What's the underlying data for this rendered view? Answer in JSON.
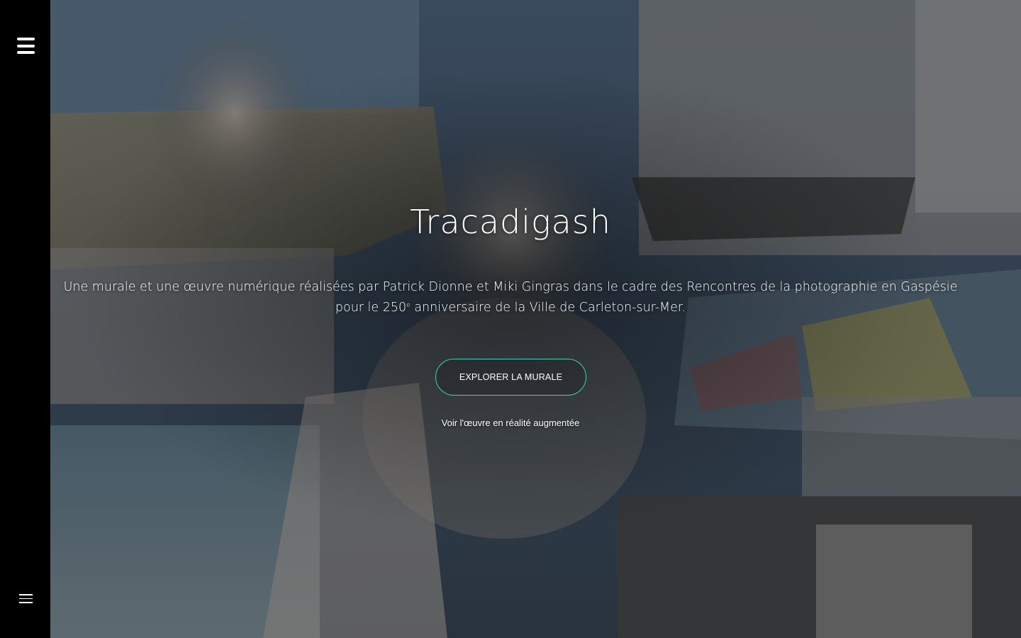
{
  "sidebar": {
    "menu_icon": "hamburger-menu-icon",
    "secondary_menu_icon": "hamburger-menu-icon-thin"
  },
  "hero": {
    "title": "Tracadigash",
    "subtitle_part1": "Une murale et une œuvre numérique réalisées par Patrick Dionne et Miki Gingras dans le cadre des Rencontres de la photographie en Gaspésie pour le 250",
    "subtitle_sup": "e",
    "subtitle_part2": " anniversaire de la Ville de Carleton-sur-Mer.",
    "explore_button": "EXPLORER LA MURALE",
    "ar_link": "Voir l'œuvre en réalité augmentée",
    "background_image": "photo-collage-mural"
  },
  "colors": {
    "sidebar_bg": "#000000",
    "button_border": "#3fd1b8",
    "text": "#ffffff"
  }
}
